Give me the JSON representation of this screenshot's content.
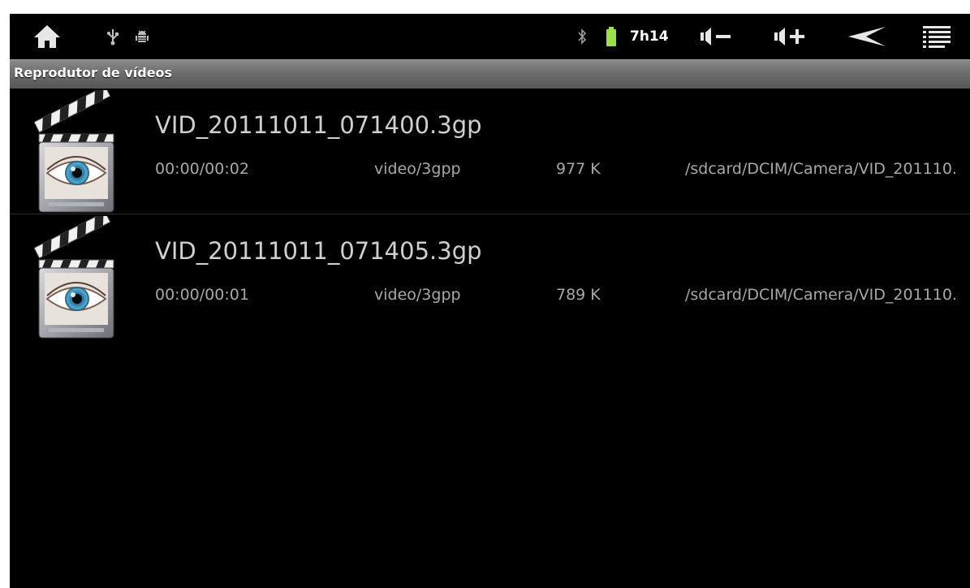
{
  "status_bar": {
    "clock": "7h14",
    "icons": {
      "home": "home-icon",
      "usb": "usb-icon",
      "debug": "android-debug-icon",
      "bluetooth": "bluetooth-icon",
      "battery": "battery-icon",
      "volume_down": "volume-down-icon",
      "volume_up": "volume-up-icon",
      "back": "back-icon",
      "menu": "menu-icon"
    },
    "battery_color": "#9be04a"
  },
  "app": {
    "title": "Reprodutor de vídeos"
  },
  "videos": [
    {
      "title": "VID_20111011_071400.3gp",
      "duration": "00:00/00:02",
      "mime": "video/3gpp",
      "size": "977 K",
      "path": "/sdcard/DCIM/Camera/VID_201110."
    },
    {
      "title": "VID_20111011_071405.3gp",
      "duration": "00:00/00:01",
      "mime": "video/3gpp",
      "size": "789 K",
      "path": "/sdcard/DCIM/Camera/VID_201110."
    }
  ]
}
